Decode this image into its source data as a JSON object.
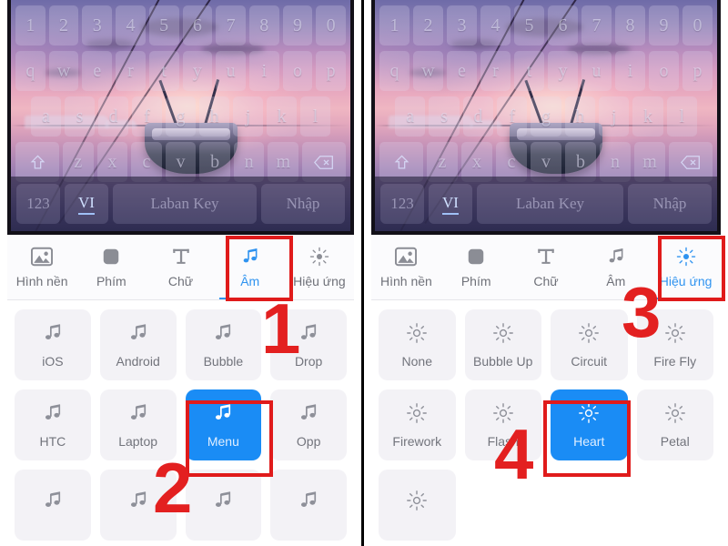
{
  "app": {
    "name": "Laban Key",
    "accent_blue": "#1a8cf5",
    "tab_active_blue": "#2f93f0",
    "tile_bg": "#f3f2f6",
    "annotation_red": "#e32020"
  },
  "keyboard": {
    "row_numbers": [
      "1",
      "2",
      "3",
      "4",
      "5",
      "6",
      "7",
      "8",
      "9",
      "0"
    ],
    "row_top": [
      "q",
      "w",
      "e",
      "r",
      "t",
      "y",
      "u",
      "i",
      "o",
      "p"
    ],
    "row_home": [
      "a",
      "s",
      "d",
      "f",
      "g",
      "h",
      "j",
      "k",
      "l"
    ],
    "row_bottom": [
      "z",
      "x",
      "c",
      "v",
      "b",
      "n",
      "m"
    ],
    "shift_icon": "shift-arrow-icon",
    "backspace_icon": "backspace-icon",
    "numeric_key": "123",
    "language_key": "VI",
    "space_key": "Laban Key",
    "enter_key": "Nhập",
    "background_name": "sunset-boat-wallpaper"
  },
  "panels": [
    {
      "id": "left",
      "tabs": [
        {
          "label": "Hình nền",
          "icon": "image-icon",
          "active": false
        },
        {
          "label": "Phím",
          "icon": "keycap-icon",
          "active": false
        },
        {
          "label": "Chữ",
          "icon": "text-t-icon",
          "active": false
        },
        {
          "label": "Âm",
          "icon": "music-note-icon",
          "active": true
        },
        {
          "label": "Hiệu ứng",
          "icon": "sun-rays-icon",
          "active": false
        }
      ],
      "grid_icon": "music-note-icon",
      "items": [
        {
          "label": "iOS",
          "selected": false
        },
        {
          "label": "Android",
          "selected": false
        },
        {
          "label": "Bubble",
          "selected": false
        },
        {
          "label": "Drop",
          "selected": false
        },
        {
          "label": "HTC",
          "selected": false
        },
        {
          "label": "Laptop",
          "selected": false
        },
        {
          "label": "Menu",
          "selected": true
        },
        {
          "label": "Opp",
          "selected": false
        },
        {
          "label": "",
          "selected": false
        },
        {
          "label": "",
          "selected": false
        },
        {
          "label": "",
          "selected": false
        },
        {
          "label": "",
          "selected": false
        }
      ]
    },
    {
      "id": "right",
      "tabs": [
        {
          "label": "Hình nền",
          "icon": "image-icon",
          "active": false
        },
        {
          "label": "Phím",
          "icon": "keycap-icon",
          "active": false
        },
        {
          "label": "Chữ",
          "icon": "text-t-icon",
          "active": false
        },
        {
          "label": "Âm",
          "icon": "music-note-icon",
          "active": false
        },
        {
          "label": "Hiệu ứng",
          "icon": "sun-rays-icon",
          "active": true
        }
      ],
      "grid_icon": "sun-rays-icon",
      "items": [
        {
          "label": "None",
          "selected": false
        },
        {
          "label": "Bubble Up",
          "selected": false
        },
        {
          "label": "Circuit",
          "selected": false
        },
        {
          "label": "Fire Fly",
          "selected": false
        },
        {
          "label": "Firework",
          "selected": false
        },
        {
          "label": "Flash",
          "selected": false
        },
        {
          "label": "Heart",
          "selected": true
        },
        {
          "label": "Petal",
          "selected": false
        },
        {
          "label": "",
          "selected": false
        }
      ]
    }
  ],
  "annotations": {
    "steps": [
      "1",
      "2",
      "3",
      "4"
    ]
  }
}
